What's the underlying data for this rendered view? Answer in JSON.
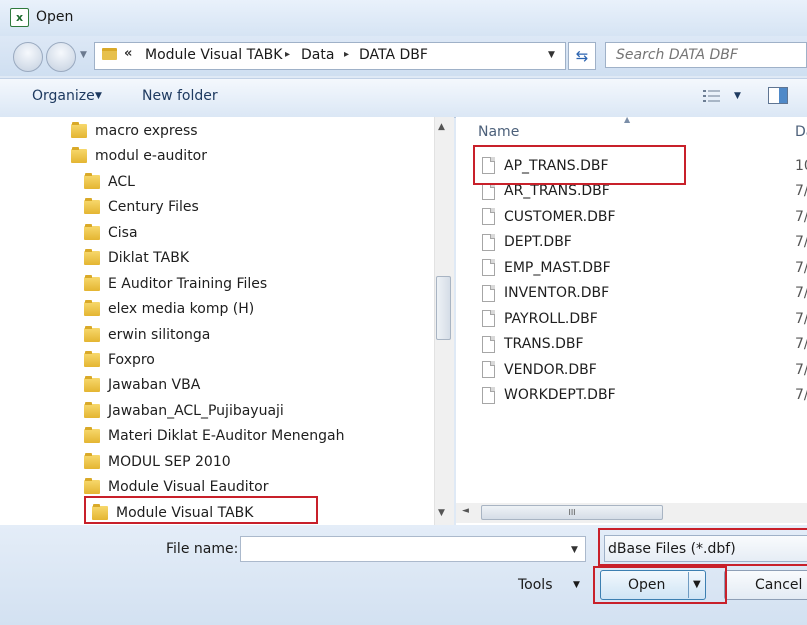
{
  "window": {
    "title": "Open",
    "app_icon_letter": "x"
  },
  "address": {
    "overflow": "«",
    "crumbs": [
      "Module Visual TABK",
      "Data",
      "DATA DBF"
    ],
    "separator": "▸"
  },
  "search": {
    "placeholder": "Search DATA DBF"
  },
  "toolbar": {
    "organize": "Organize",
    "new_folder": "New folder"
  },
  "tree": [
    {
      "label": "macro express",
      "level": 1
    },
    {
      "label": "modul e-auditor",
      "level": 1
    },
    {
      "label": "ACL",
      "level": 2
    },
    {
      "label": "Century Files",
      "level": 2
    },
    {
      "label": "Cisa",
      "level": 2
    },
    {
      "label": "Diklat TABK",
      "level": 2
    },
    {
      "label": "E Auditor Training Files",
      "level": 2
    },
    {
      "label": "elex media komp (H)",
      "level": 2
    },
    {
      "label": "erwin silitonga",
      "level": 2
    },
    {
      "label": "Foxpro",
      "level": 2
    },
    {
      "label": "Jawaban VBA",
      "level": 2
    },
    {
      "label": "Jawaban_ACL_Pujibayuaji",
      "level": 2
    },
    {
      "label": "Materi Diklat E-Auditor Menengah",
      "level": 2
    },
    {
      "label": "MODUL SEP 2010",
      "level": 2
    },
    {
      "label": "Module Visual Eauditor",
      "level": 2
    },
    {
      "label": "Module Visual TABK",
      "level": 2,
      "selected": true
    }
  ],
  "files": {
    "columns": {
      "name": "Name",
      "date": "Da"
    },
    "rows": [
      {
        "name": "AP_TRANS.DBF",
        "date": "10"
      },
      {
        "name": "AR_TRANS.DBF",
        "date": "7/"
      },
      {
        "name": "CUSTOMER.DBF",
        "date": "7/"
      },
      {
        "name": "DEPT.DBF",
        "date": "7/"
      },
      {
        "name": "EMP_MAST.DBF",
        "date": "7/"
      },
      {
        "name": "INVENTOR.DBF",
        "date": "7/"
      },
      {
        "name": "PAYROLL.DBF",
        "date": "7/"
      },
      {
        "name": "TRANS.DBF",
        "date": "7/"
      },
      {
        "name": "VENDOR.DBF",
        "date": "7/"
      },
      {
        "name": "WORKDEPT.DBF",
        "date": "7/"
      }
    ]
  },
  "bottom": {
    "file_name_label": "File name:",
    "file_name_value": "",
    "file_type": "dBase Files (*.dbf)",
    "tools_label": "Tools",
    "open_label": "Open",
    "cancel_label": "Cancel"
  },
  "colors": {
    "highlight": "#c8202a",
    "folder": "#e4b532",
    "accent": "#3c7fb1"
  }
}
